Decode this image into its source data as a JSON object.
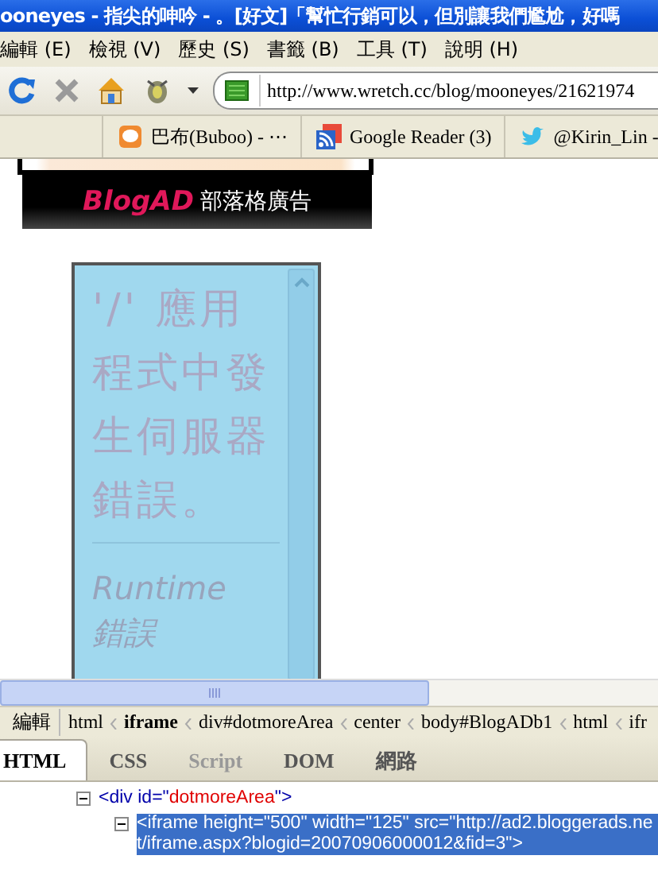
{
  "window": {
    "title": "ooneyes - 指尖的呻吟 - 。[好文]「幫忙行銷可以，但別讓我們尷尬，好嗎"
  },
  "menu": [
    "編輯 (E)",
    "檢視 (V)",
    "歷史 (S)",
    "書籤 (B)",
    "工具 (T)",
    "說明 (H)"
  ],
  "toolbar": {
    "url": "http://www.wretch.cc/blog/mooneyes/21621974"
  },
  "bookmarks": [
    {
      "kind": "chat",
      "label": "巴布(Buboo) - ⋯"
    },
    {
      "kind": "feed",
      "label": "Google Reader (3)"
    },
    {
      "kind": "bird",
      "label": "@Kirin_Lin -"
    }
  ],
  "page": {
    "banner": {
      "brand": "BlogAD",
      "label": "部落格廣告"
    },
    "iframe": {
      "heading": "'/' 應用程式中發生伺服器錯誤。",
      "subheading": "Runtime 錯誤"
    }
  },
  "firebug": {
    "edit_button": "編輯",
    "breadcrumbs": [
      {
        "label": "html",
        "selected": false
      },
      {
        "label": "iframe",
        "selected": true
      },
      {
        "label": "div#dotmoreArea",
        "selected": false
      },
      {
        "label": "center",
        "selected": false
      },
      {
        "label": "body#BlogADb1",
        "selected": false
      },
      {
        "label": "html",
        "selected": false
      },
      {
        "label": "ifr",
        "selected": false
      }
    ],
    "tabs": [
      {
        "label": "HTML",
        "selected": true,
        "disabled": false
      },
      {
        "label": "CSS",
        "selected": false,
        "disabled": false
      },
      {
        "label": "Script",
        "selected": false,
        "disabled": true
      },
      {
        "label": "DOM",
        "selected": false,
        "disabled": false
      },
      {
        "label": "網路",
        "selected": false,
        "disabled": false
      }
    ],
    "tree": [
      {
        "expanded": true,
        "selected": false,
        "parts": [
          {
            "kind": "tag",
            "text": "<div"
          },
          {
            "kind": "attr",
            "text": " id=\""
          },
          {
            "kind": "value",
            "text": "dotmoreArea"
          },
          {
            "kind": "attr",
            "text": "\">"
          }
        ]
      },
      {
        "expanded": true,
        "selected": true,
        "parts": [
          {
            "kind": "tag",
            "text": "<iframe"
          },
          {
            "kind": "attr",
            "text": " height=\""
          },
          {
            "kind": "value",
            "text": "500"
          },
          {
            "kind": "attr",
            "text": "\" width=\""
          },
          {
            "kind": "value",
            "text": "125"
          },
          {
            "kind": "attr",
            "text": "\" src=\""
          },
          {
            "kind": "value",
            "text": "http://ad2.bloggerads.net/iframe.aspx?blogid=20070906000012&fid=3"
          },
          {
            "kind": "attr",
            "text": "\">"
          }
        ]
      }
    ]
  }
}
